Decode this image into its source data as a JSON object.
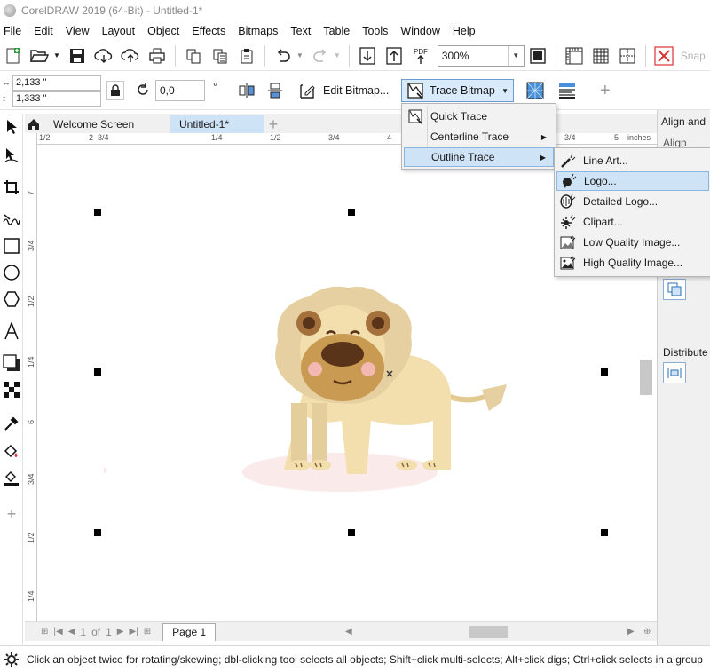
{
  "window": {
    "title": "CorelDRAW 2019 (64-Bit) - Untitled-1*"
  },
  "menubar": [
    "File",
    "Edit",
    "View",
    "Layout",
    "Object",
    "Effects",
    "Bitmaps",
    "Text",
    "Table",
    "Tools",
    "Window",
    "Help"
  ],
  "toolbar": {
    "zoom_value": "300%",
    "snap_label": "Snap"
  },
  "property_bar": {
    "width_value": "2,133 \"",
    "height_value": "1,333 \"",
    "angle_value": "0,0",
    "angle_unit": "°",
    "edit_bitmap_label": "Edit Bitmap...",
    "trace_bitmap_label": "Trace Bitmap"
  },
  "doc_tabs": {
    "welcome": "Welcome Screen",
    "active": "Untitled-1*"
  },
  "ruler": {
    "h_labels": [
      "1/2",
      "2",
      "3/4",
      "1/4",
      "1/2",
      "3/4",
      "4",
      "3/4",
      "5",
      "inches"
    ],
    "v_labels": [
      "7",
      "3/4",
      "1/2",
      "1/4",
      "6",
      "3/4",
      "1/2",
      "1/4"
    ]
  },
  "trace_menu": {
    "items": [
      {
        "label": "Quick Trace",
        "icon": "quick-trace-icon"
      },
      {
        "label": "Centerline Trace",
        "icon": "",
        "has_submenu": true
      },
      {
        "label": "Outline Trace",
        "icon": "",
        "has_submenu": true,
        "highlighted": true
      }
    ]
  },
  "outline_submenu": {
    "items": [
      {
        "label": "Line Art...",
        "icon": "line-art-icon"
      },
      {
        "label": "Logo...",
        "icon": "logo-icon",
        "highlighted": true
      },
      {
        "label": "Detailed Logo...",
        "icon": "detailed-logo-icon"
      },
      {
        "label": "Clipart...",
        "icon": "clipart-icon"
      },
      {
        "label": "Low Quality Image...",
        "icon": "low-quality-image-icon"
      },
      {
        "label": "High Quality Image...",
        "icon": "high-quality-image-icon"
      }
    ]
  },
  "right_panel": {
    "header": "Align and",
    "sub": "Align",
    "distribute": "Distribute"
  },
  "page_nav": {
    "current": "1",
    "of_label": "of",
    "total": "1",
    "page_tab": "Page 1"
  },
  "status": {
    "text": "Click an object twice for rotating/skewing; dbl-clicking tool selects all objects; Shift+click multi-selects; Alt+click digs; Ctrl+click selects in a group"
  },
  "colors": {
    "accent": "#cfe3f7",
    "accent_border": "#8ab5e3",
    "lion_mane": "#e6cfa0",
    "lion_body": "#f3dfae",
    "lion_face": "#c99a52",
    "shadow": "#fbe9ea"
  }
}
